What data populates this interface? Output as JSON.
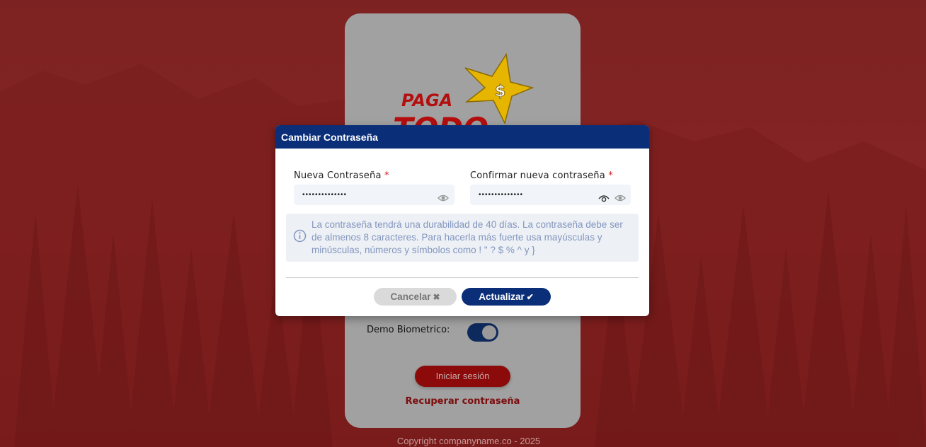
{
  "background": {
    "color": "#7d2222"
  },
  "login_card": {
    "logo_text_line1": "PAGA",
    "logo_text_line2": "TODO",
    "logo_symbol": "$",
    "biometric_label": "Demo Biometrico:",
    "biometric_enabled": true,
    "login_button": "Iniciar sesión",
    "recover_link": "Recuperar contraseña"
  },
  "footer": {
    "copyright": "Copyright companyname.co - 2025"
  },
  "modal": {
    "title": "Cambiar Contraseña",
    "new_password": {
      "label": "Nueva Contraseña",
      "required_mark": "*",
      "value": "••••••••••••••",
      "icon": "eye-icon"
    },
    "confirm_password": {
      "label": "Confirmar nueva contraseña",
      "required_mark": "*",
      "value": "••••••••••••••",
      "icons": [
        "eye-icon",
        "eye-icon"
      ]
    },
    "info": {
      "icon": "info-icon",
      "text": "La contraseña tendrá una durabilidad de 40 días. La contraseña debe ser de almenos 8 caracteres. Para hacerla más fuerte usa mayúsculas y minúsculas, números y símbolos como ! \" ? $ % ^ y }"
    },
    "cancel_button": {
      "label": "Cancelar",
      "icon": "times-icon"
    },
    "update_button": {
      "label": "Actualizar",
      "icon": "check-icon"
    }
  },
  "colors": {
    "primary": "#0a2e78",
    "accent_red": "#8d0a0a",
    "required": "#d01a1a",
    "info_text": "#8395bf"
  }
}
